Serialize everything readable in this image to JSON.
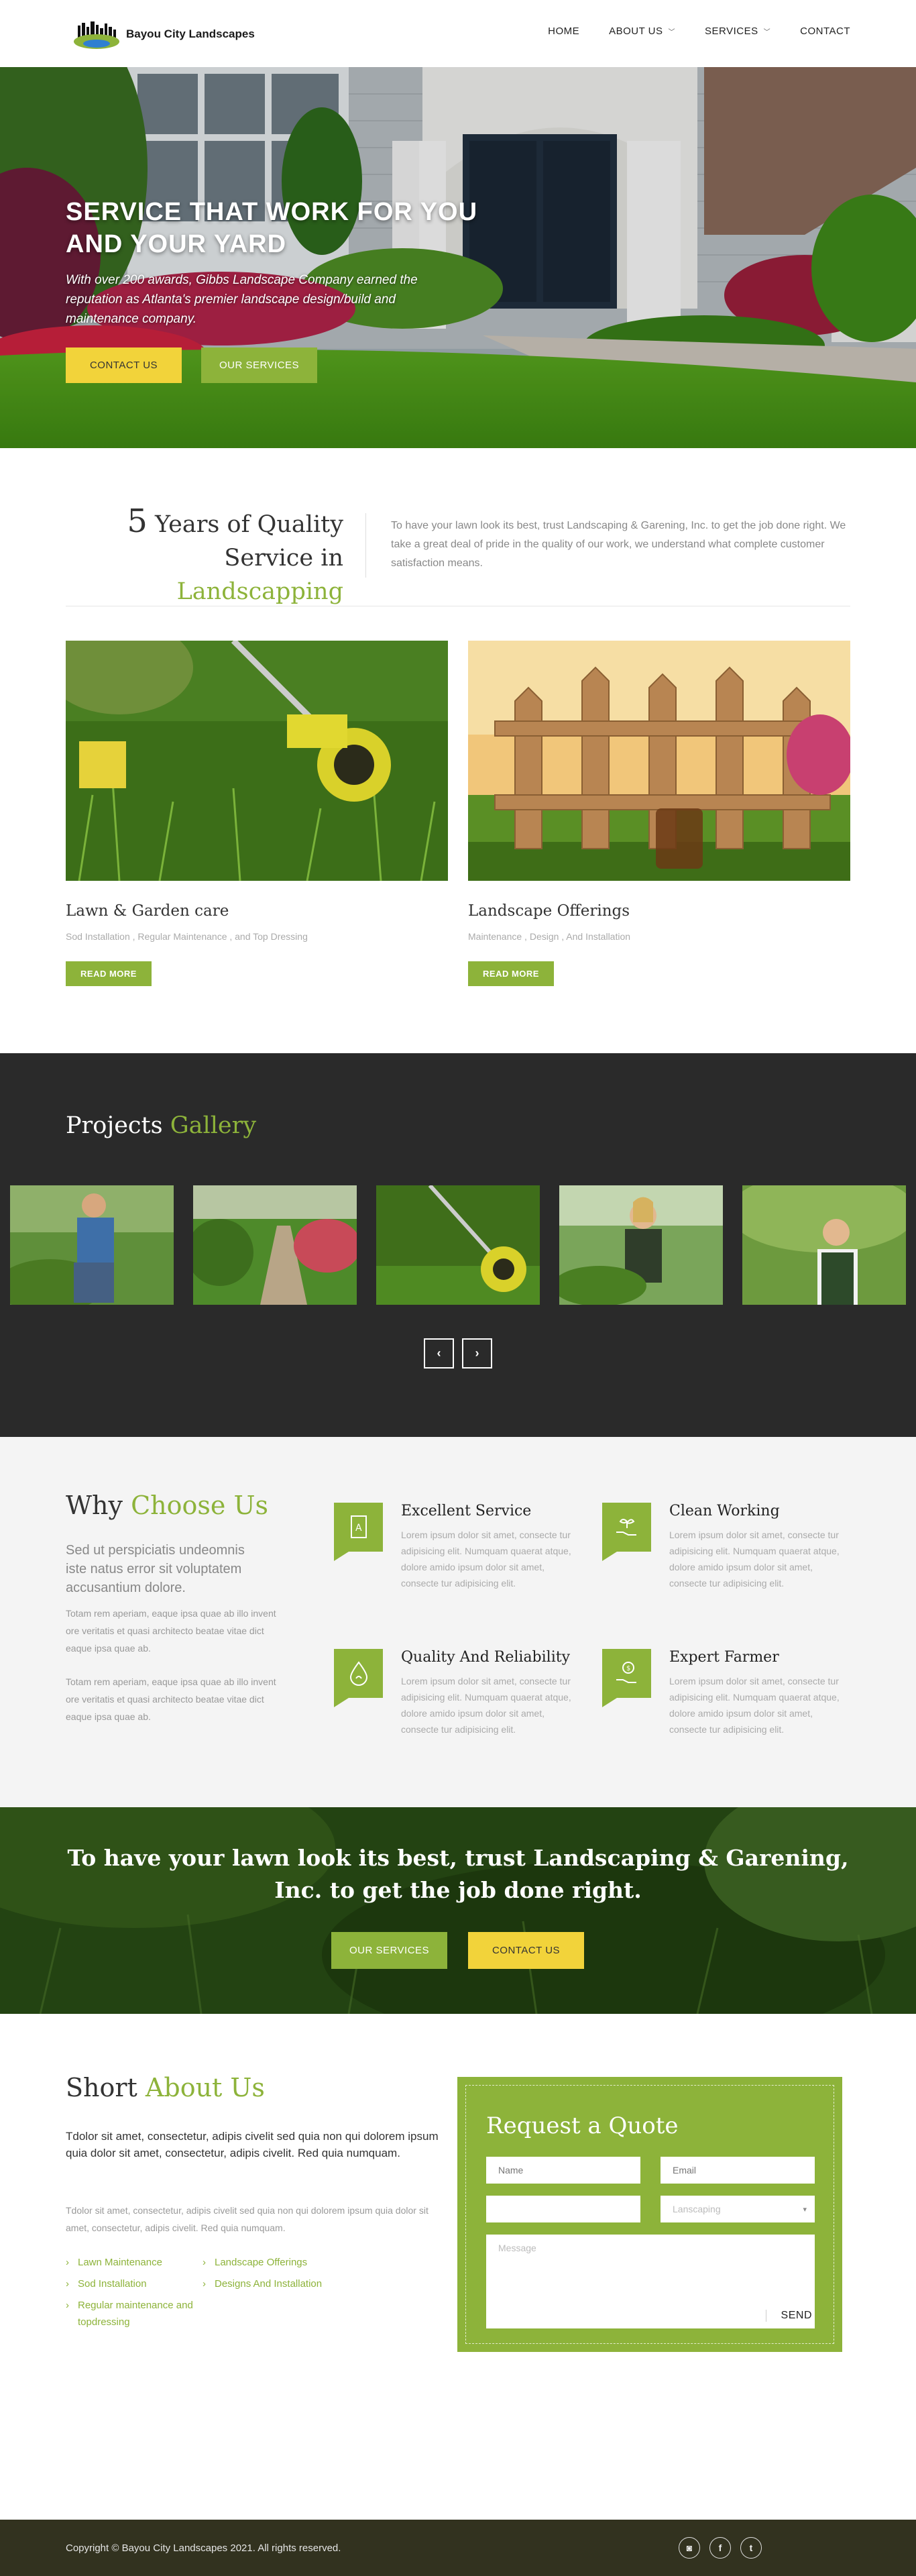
{
  "brand": {
    "name": "Bayou City Landscapes"
  },
  "nav": {
    "items": [
      {
        "label": "HOME",
        "dropdown": false
      },
      {
        "label": "ABOUT US",
        "dropdown": true
      },
      {
        "label": "SERVICES",
        "dropdown": true
      },
      {
        "label": "CONTACT",
        "dropdown": false
      }
    ]
  },
  "hero": {
    "title": "SERVICE THAT WORK FOR YOU AND YOUR YARD",
    "subtitle": "With over 200 awards, Gibbs Landscape Company earned the reputation as Atlanta's premier landscape design/build and maintenance company.",
    "btn_contact": "CONTACT US",
    "btn_services": "OUR SERVICES"
  },
  "intro": {
    "years": "5",
    "title_part1": "Years of Quality",
    "title_part2": "Service in",
    "title_accent": "Landscapping",
    "text": "To have your lawn look its best, trust Landscaping & Garening, Inc. to get the job done right. We take a great deal of pride in the quality of our work, we understand what complete customer satisfaction means."
  },
  "services": [
    {
      "title": "Lawn & Garden care",
      "subtitle": "Sod Installation , Regular Maintenance , and Top Dressing",
      "button": "READ MORE"
    },
    {
      "title": "Landscape Offerings",
      "subtitle": "Maintenance , Design , And Installation",
      "button": "READ MORE"
    }
  ],
  "gallery": {
    "title_part1": "Projects",
    "title_accent": "Gallery",
    "prev_icon": "chevron-left-icon",
    "next_icon": "chevron-right-icon"
  },
  "why": {
    "title_part1": "Why",
    "title_accent": "Choose Us",
    "lead": "Sed ut perspiciatis undeomnis iste natus error sit voluptatem accusantium dolore.",
    "para1": "Totam rem aperiam, eaque ipsa quae ab illo invent ore veritatis et quasi architecto beatae vitae dict eaque ipsa quae ab.",
    "para2": "Totam rem aperiam, eaque ipsa quae ab illo invent ore veritatis et quasi architecto beatae vitae dict eaque ipsa quae ab.",
    "features": [
      {
        "title": "Excellent Service",
        "text": "Lorem ipsum dolor sit amet, consecte tur adipisicing elit. Numquam quaerat atque, dolore amido ipsum dolor sit amet, consecte tur adipisicing elit.",
        "icon": "document-icon"
      },
      {
        "title": "Clean Working",
        "text": "Lorem ipsum dolor sit amet, consecte tur adipisicing elit. Numquam quaerat atque, dolore amido ipsum dolor sit amet, consecte tur adipisicing elit.",
        "icon": "hand-plant-icon"
      },
      {
        "title": "Quality And Reliability",
        "text": "Lorem ipsum dolor sit amet, consecte tur adipisicing elit. Numquam quaerat atque, dolore amido ipsum dolor sit amet, consecte tur adipisicing elit.",
        "icon": "water-drop-icon"
      },
      {
        "title": "Expert Farmer",
        "text": "Lorem ipsum dolor sit amet, consecte tur adipisicing elit. Numquam quaerat atque, dolore amido ipsum dolor sit amet, consecte tur adipisicing elit.",
        "icon": "money-hand-icon"
      }
    ]
  },
  "cta": {
    "text": "To have your lawn look its best, trust Landscaping & Garening, Inc. to get the job done right.",
    "btn_services": "OUR SERVICES",
    "btn_contact": "CONTACT US"
  },
  "about": {
    "title_part1": "Short",
    "title_accent": "About Us",
    "lead": "Tdolor sit amet, consectetur, adipis civelit sed quia non qui dolorem ipsum quia dolor sit amet, consectetur, adipis civelit. Red quia numquam.",
    "para": "Tdolor sit amet, consectetur, adipis civelit sed quia non qui dolorem ipsum quia dolor sit amet, consectetur, adipis civelit. Red quia numquam.",
    "list_left": [
      "Lawn Maintenance",
      "Sod Installation",
      "Regular maintenance and topdressing"
    ],
    "list_right": [
      "Landscape Offerings",
      "Designs And Installation"
    ]
  },
  "quote": {
    "title": "Request a Quote",
    "name_placeholder": "Name",
    "email_placeholder": "Email",
    "phone_placeholder": "",
    "service_selected": "Lanscaping",
    "message_placeholder": "Message",
    "send": "SEND"
  },
  "footer": {
    "copyright": "Copyright © Bayou City Landscapes 2021. All rights reserved.",
    "socials": [
      {
        "icon": "instagram-icon",
        "glyph": "◙"
      },
      {
        "icon": "facebook-icon",
        "glyph": "f"
      },
      {
        "icon": "twitter-icon",
        "glyph": "t"
      }
    ]
  },
  "colors": {
    "accent": "#8db33a",
    "yellow": "#f2d33a",
    "dark": "#2a2a2a",
    "footer": "#32321f"
  }
}
